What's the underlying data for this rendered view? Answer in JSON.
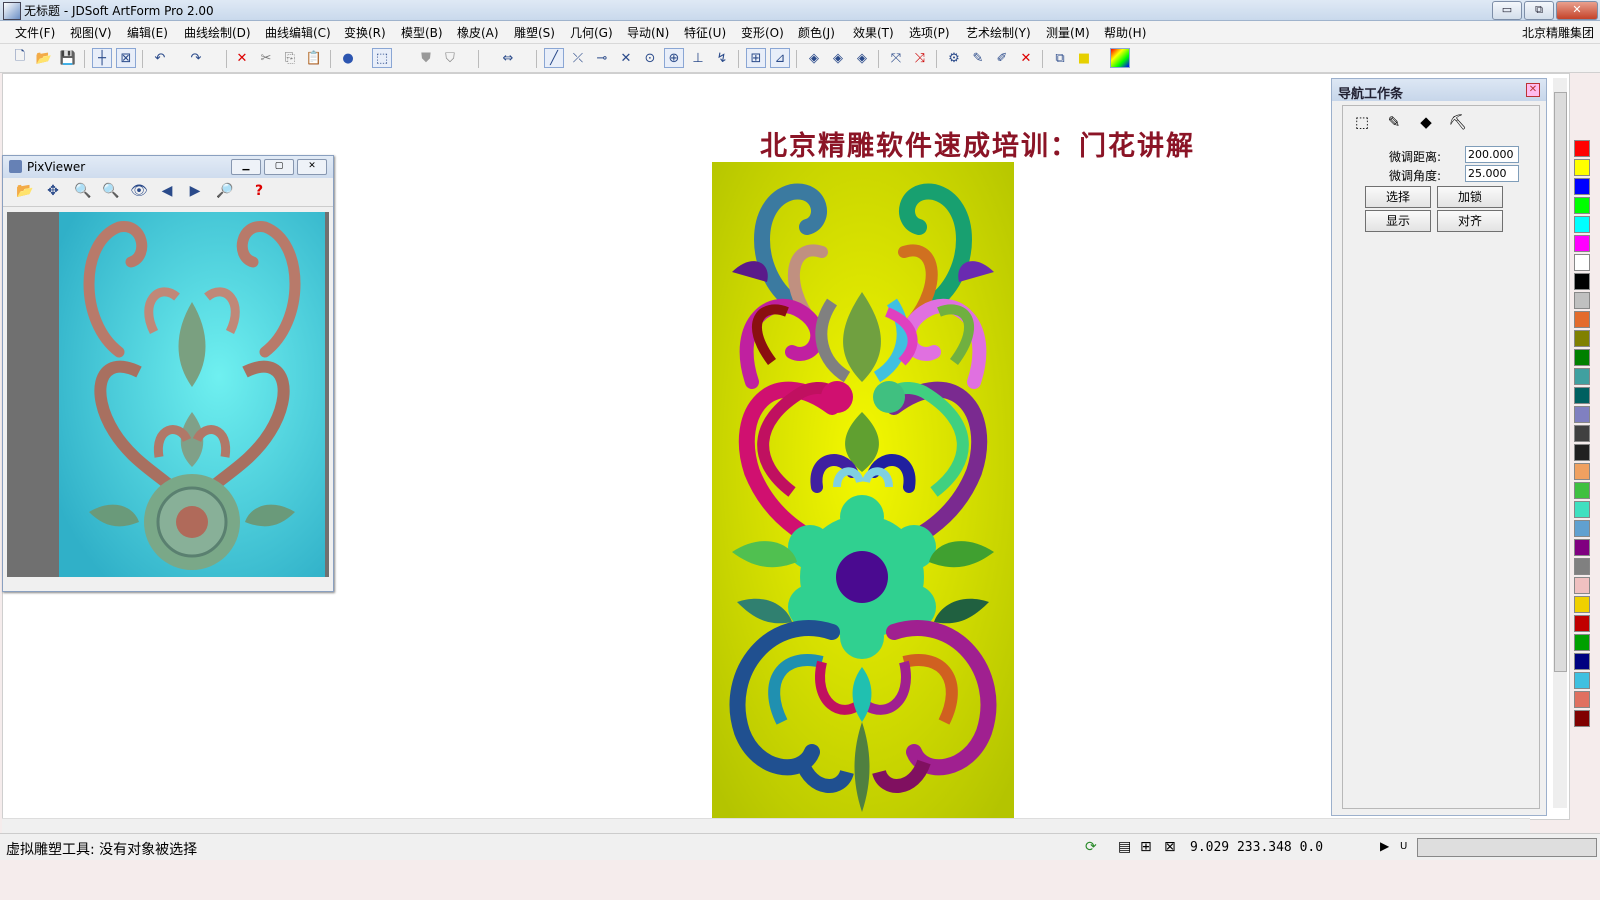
{
  "window": {
    "title": "无标题 - JDSoft ArtForm Pro 2.00",
    "min": "▭",
    "restore": "⧉",
    "close": "✕"
  },
  "menu": {
    "items": [
      "文件(F)",
      "视图(V)",
      "编辑(E)",
      "曲线绘制(D)",
      "曲线编辑(C)",
      "变换(R)",
      "模型(B)",
      "橡皮(A)",
      "雕塑(S)",
      "几何(G)",
      "导动(N)",
      "特征(U)",
      "变形(O)",
      "颜色(J)",
      "效果(T)",
      "选项(P)",
      "艺术绘制(Y)",
      "测量(M)",
      "帮助(H)"
    ],
    "company": "北京精雕集团"
  },
  "pixviewer": {
    "title": "PixViewer",
    "tools": [
      "📂",
      "✥",
      "🔍",
      "🔍",
      "👁",
      "◀",
      "▶",
      "🔎",
      "?"
    ]
  },
  "canvas": {
    "title": "北京精雕软件速成培训：门花讲解"
  },
  "nav_panel": {
    "title": "导航工作条",
    "distance_label": "微调距离:",
    "distance_value": "200.000",
    "angle_label": "微调角度:",
    "angle_value": "25.000",
    "btn_select": "选择",
    "btn_lock": "加锁",
    "btn_show": "显示",
    "btn_align": "对齐"
  },
  "status": {
    "message": "虚拟雕塑工具: 没有对象被选择",
    "coords": "9.029 233.348 0.0",
    "unit": "U"
  },
  "palette": [
    "#ff0000",
    "#ffff00",
    "#0000ff",
    "#00ff00",
    "#00ffff",
    "#ff00ff",
    "#ffffff",
    "#000000",
    "#c0c0c0",
    "#e36b2c",
    "#808000",
    "#008000",
    "#40a0a0",
    "#006060",
    "#8080c0",
    "#404040",
    "#202020",
    "#f0a060",
    "#40c040",
    "#40e0c0",
    "#60a0d0",
    "#800080",
    "#808080",
    "#f0c0c0",
    "#f0d000",
    "#c00000",
    "#00a000",
    "#000080",
    "#40c0e0",
    "#e07060",
    "#800000"
  ],
  "colors": {
    "canvas_title": "#8b1426",
    "art_bg": "#c8d200"
  }
}
